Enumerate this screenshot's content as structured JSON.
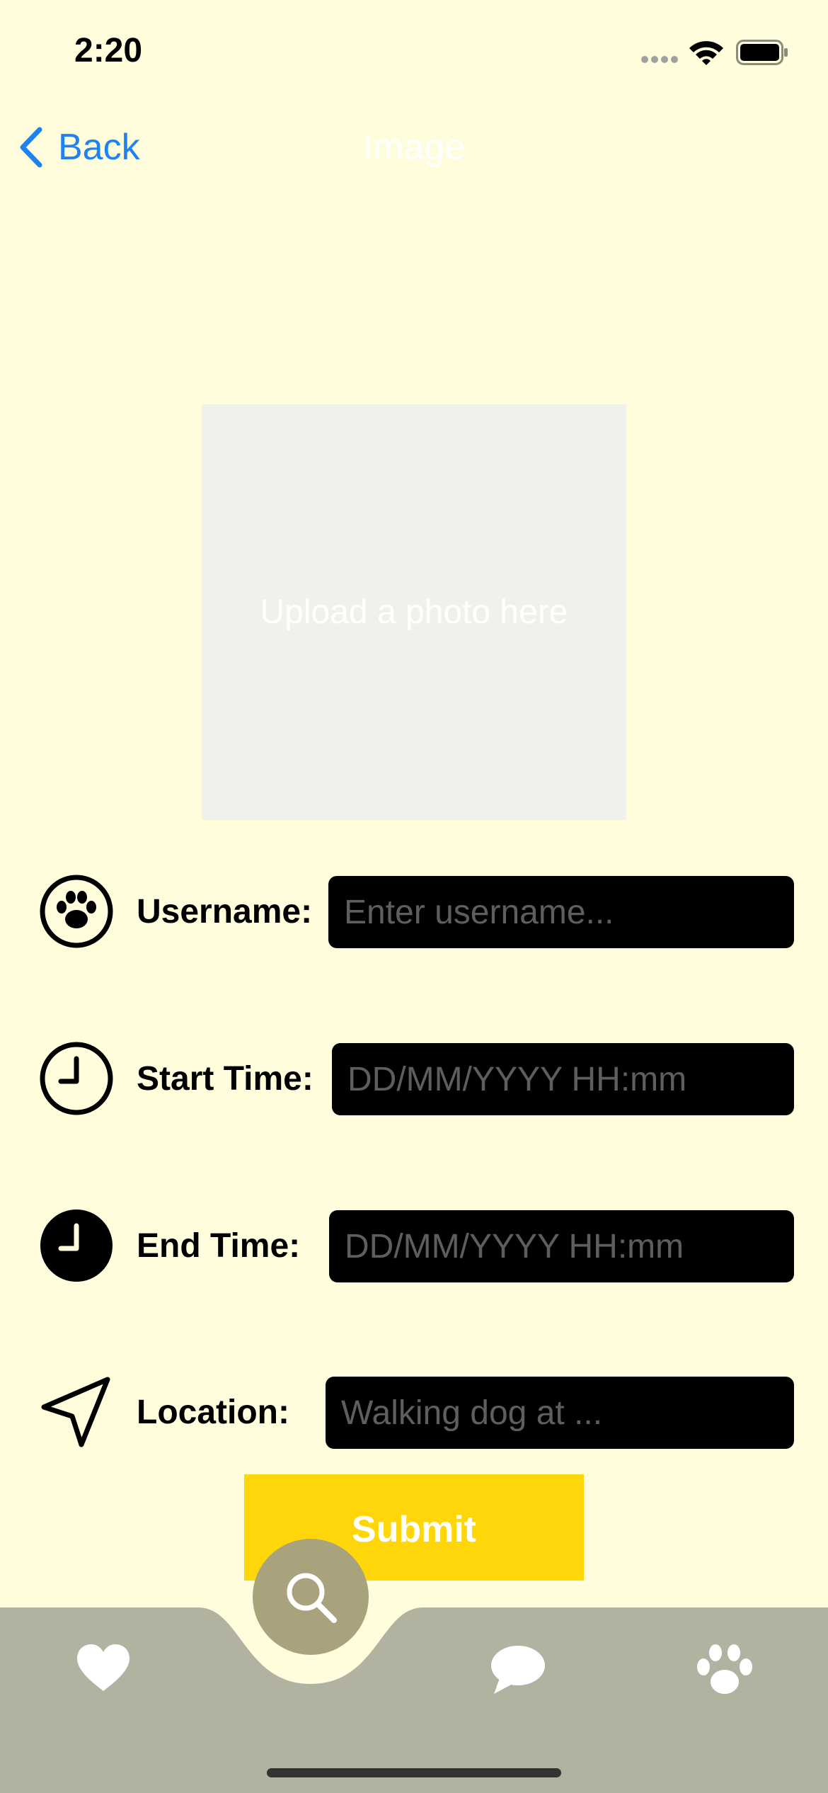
{
  "status": {
    "time": "2:20"
  },
  "nav": {
    "back_label": "Back",
    "title": "Image"
  },
  "photo": {
    "placeholder": "Upload a photo here"
  },
  "form": {
    "username": {
      "label": "Username:",
      "placeholder": "Enter username..."
    },
    "start_time": {
      "label": "Start Time:",
      "placeholder": "DD/MM/YYYY HH:mm"
    },
    "end_time": {
      "label": "End Time:",
      "placeholder": "DD/MM/YYYY HH:mm"
    },
    "location": {
      "label": "Location:",
      "placeholder": "Walking dog at ..."
    },
    "submit_label": "Submit"
  },
  "icons": {
    "username": "paw-circle-icon",
    "start_time": "clock-outline-icon",
    "end_time": "clock-filled-icon",
    "location": "location-arrow-icon",
    "tabs": [
      "heart-icon",
      "search-icon",
      "chat-bubble-icon",
      "paw-icon"
    ]
  },
  "colors": {
    "background": "#FFFDDC",
    "accent_blue": "#1E82F0",
    "submit": "#FFD60A",
    "tabbar": "#B1B2A0",
    "search_tab": "#A9A37D",
    "photo_placeholder": "#F1F1EC"
  }
}
